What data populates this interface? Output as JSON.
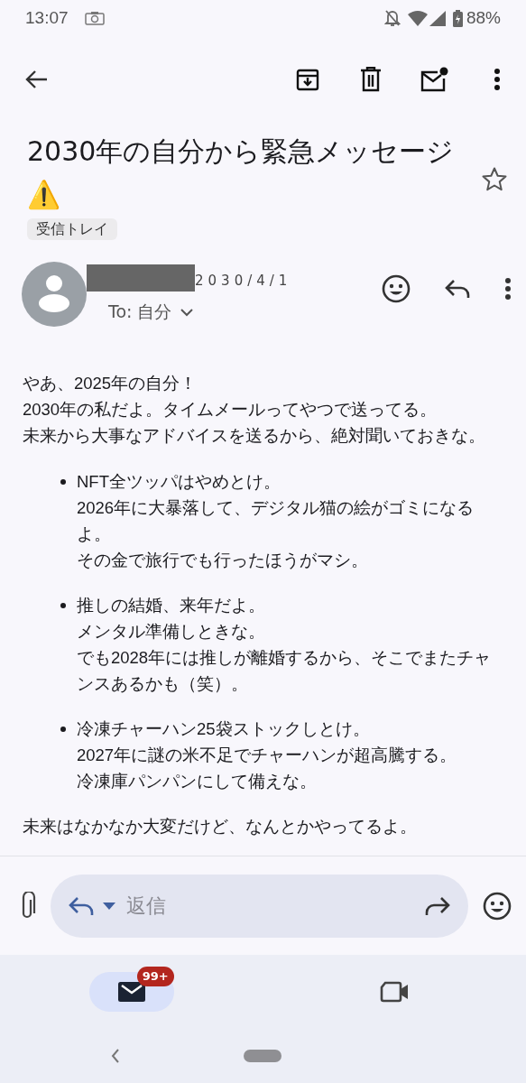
{
  "status_bar": {
    "time": "13:07",
    "battery": "88%"
  },
  "email": {
    "subject": "2030年の自分から緊急メッセージ⚠️",
    "label": "受信トレイ",
    "starred": false,
    "date": "2030/4/1",
    "to": "To: 自分",
    "intro": [
      "やあ、2025年の自分！",
      "2030年の私だよ。タイムメールってやつで送ってる。",
      "未来から大事なアドバイスを送るから、絶対聞いておきな。"
    ],
    "bullets": [
      {
        "lines": [
          "NFT全ツッパはやめとけ。",
          "2026年に大暴落して、デジタル猫の絵がゴミになるよ。",
          "その金で旅行でも行ったほうがマシ。"
        ]
      },
      {
        "lines": [
          "推しの結婚、来年だよ。",
          "メンタル準備しときな。",
          "でも2028年には推しが離婚するから、そこでまたチャンスあるかも（笑）。"
        ]
      },
      {
        "lines": [
          "冷凍チャーハン25袋ストックしとけ。",
          "2027年に謎の米不足でチャーハンが超高騰する。",
          "冷凍庫パンパンにして備えな。"
        ]
      }
    ],
    "outro": "未来はなかなか大変だけど、なんとかやってるよ。"
  },
  "composer": {
    "placeholder": "返信"
  },
  "bottom_nav": [
    {
      "kind": "mail",
      "selected": true,
      "badge": "99+"
    },
    {
      "kind": "video",
      "selected": false
    }
  ]
}
